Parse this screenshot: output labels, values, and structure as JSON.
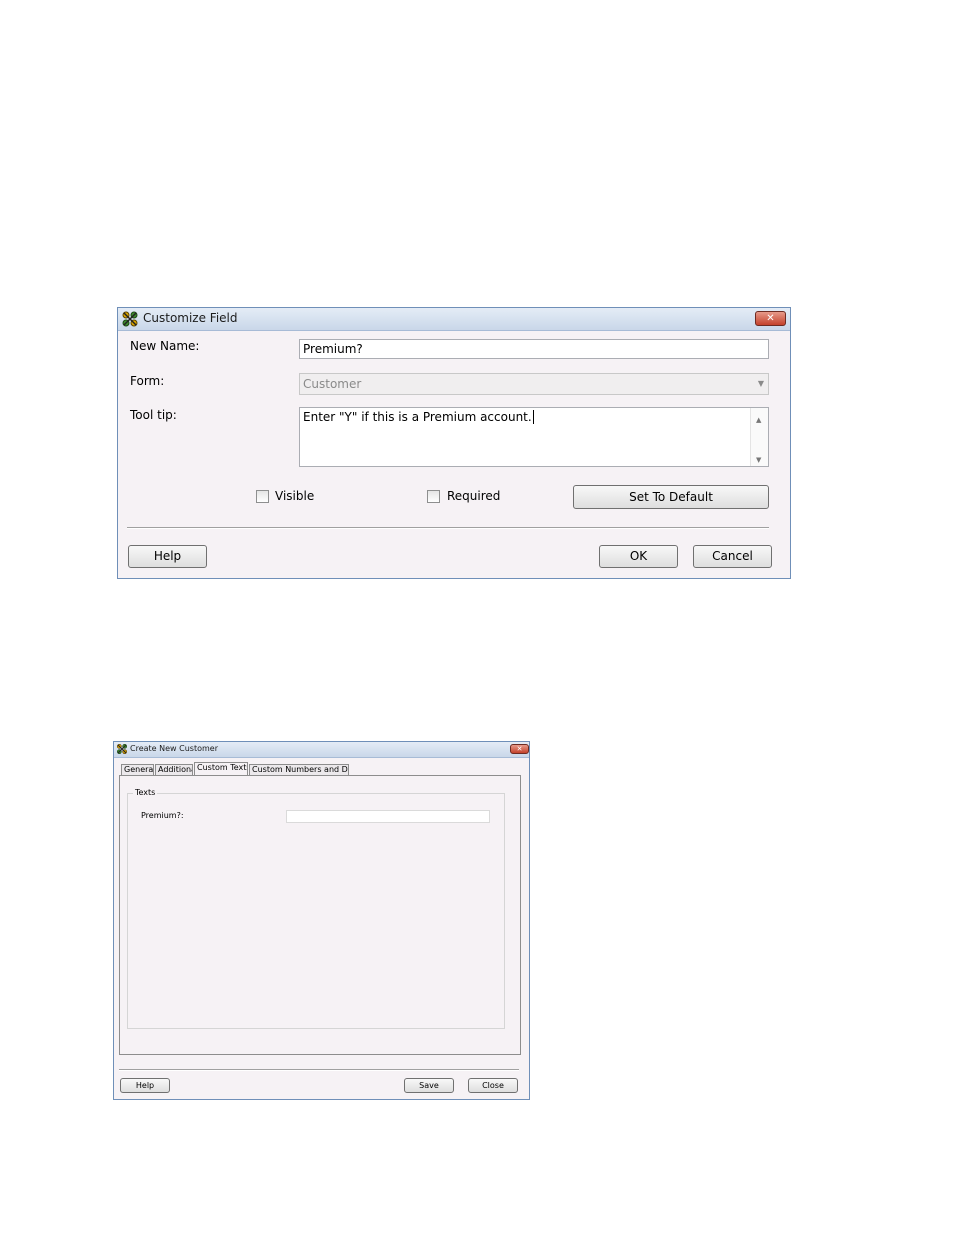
{
  "customize_field": {
    "title": "Customize Field",
    "new_name_label": "New Name:",
    "new_name_value": "Premium?",
    "form_label": "Form:",
    "form_value": "Customer",
    "tooltip_label": "Tool tip:",
    "tooltip_value": "Enter \"Y\" if this is a Premium account.",
    "visible_label": "Visible",
    "required_label": "Required",
    "set_default_label": "Set To Default",
    "help_label": "Help",
    "ok_label": "OK",
    "cancel_label": "Cancel"
  },
  "create_customer": {
    "title": "Create New Customer",
    "tabs": [
      {
        "label": "General"
      },
      {
        "label": "Additional"
      },
      {
        "label": "Custom Texts"
      },
      {
        "label": "Custom Numbers and Dates"
      }
    ],
    "group_label": "Texts",
    "premium_label": "Premium?:",
    "premium_value": "",
    "help_label": "Help",
    "save_label": "Save",
    "close_label": "Close"
  }
}
